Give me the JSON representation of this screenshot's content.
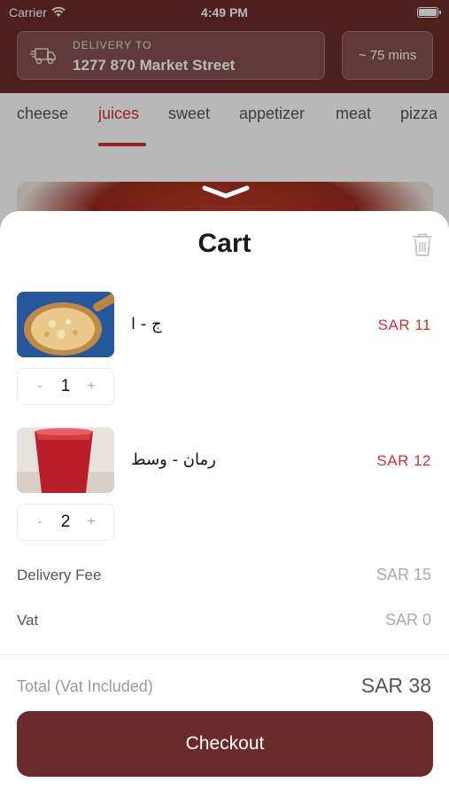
{
  "status_bar": {
    "carrier": "Carrier",
    "time": "4:49 PM"
  },
  "header": {
    "delivery_label": "DELIVERY TO",
    "delivery_address": "1277 870 Market Street",
    "eta": "~ 75 mins"
  },
  "categories": [
    {
      "label": "cheese",
      "active": false
    },
    {
      "label": "juices",
      "active": true
    },
    {
      "label": "sweet",
      "active": false
    },
    {
      "label": "appetizer",
      "active": false
    },
    {
      "label": "meat",
      "active": false
    },
    {
      "label": "pizza",
      "active": false
    }
  ],
  "cart": {
    "title": "Cart",
    "items": [
      {
        "name": "ج - ا",
        "price": "SAR 11",
        "qty": "1",
        "minus": "-",
        "plus": "+"
      },
      {
        "name": "رمان - وسط",
        "price": "SAR 12",
        "qty": "2",
        "minus": "-",
        "plus": "+"
      }
    ],
    "delivery_fee_label": "Delivery Fee",
    "delivery_fee_value": "SAR 15",
    "vat_label": "Vat",
    "vat_value": "SAR 0",
    "total_label": "Total",
    "total_note": "(Vat Included)",
    "total_value": "SAR 38",
    "checkout_label": "Checkout"
  },
  "colors": {
    "brand": "#6b2b2b",
    "accent": "#d0313a"
  }
}
